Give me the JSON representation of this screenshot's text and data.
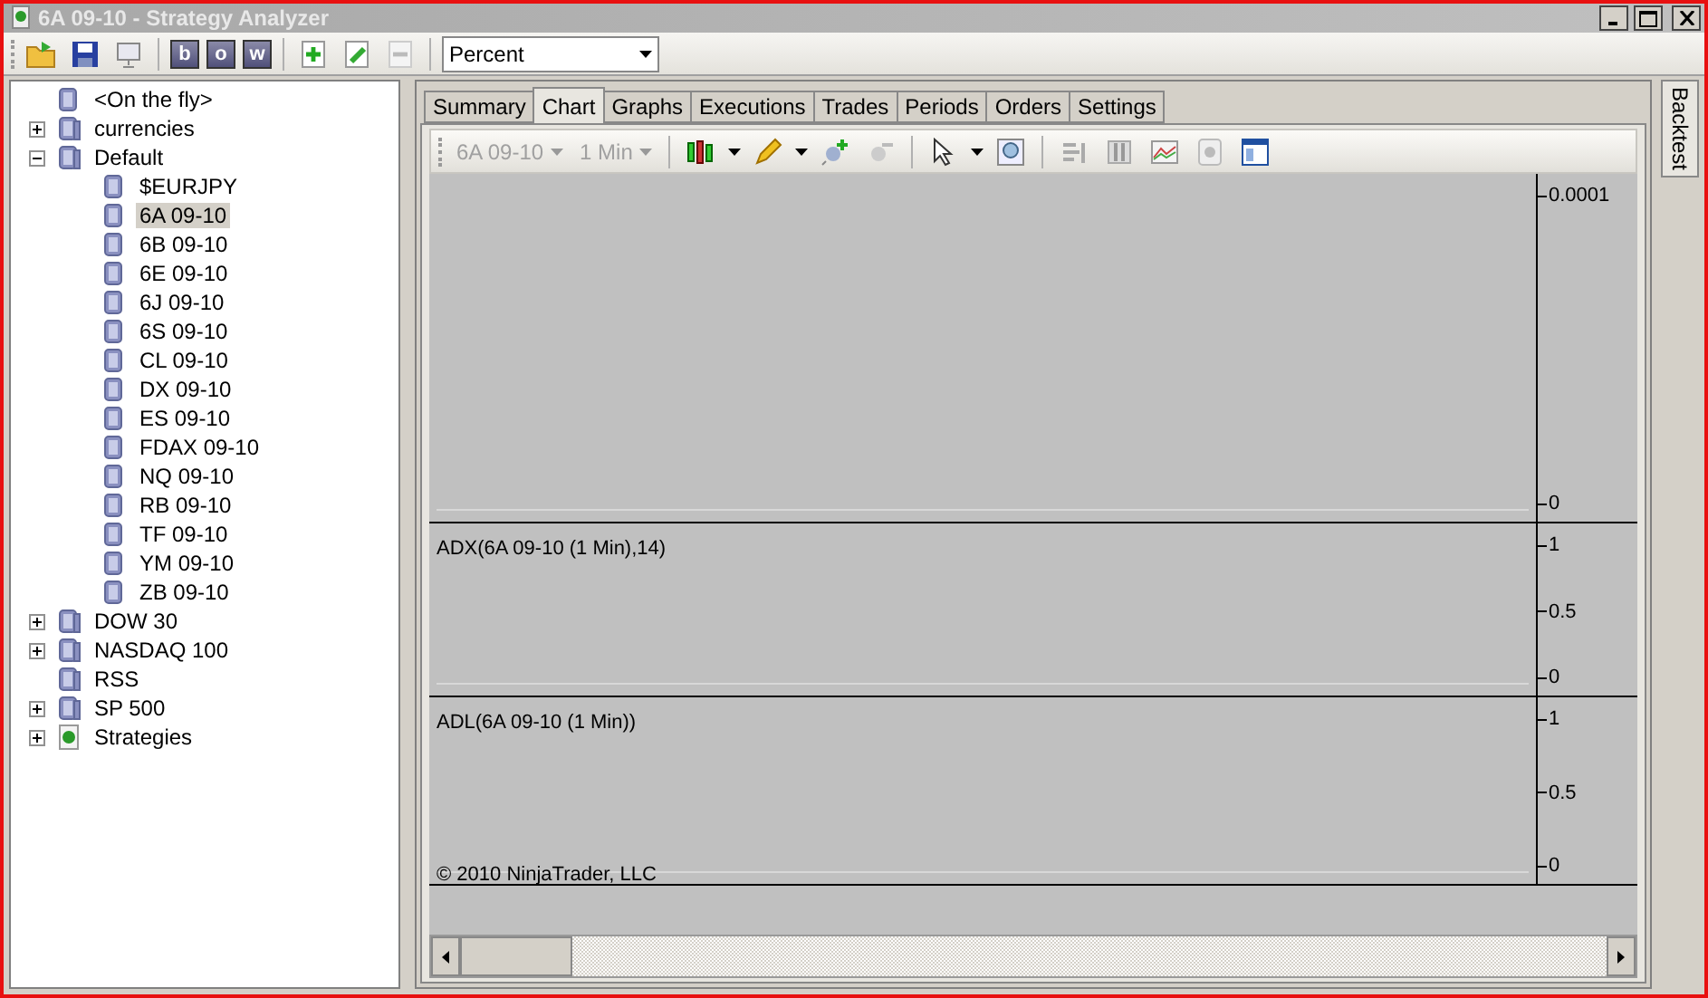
{
  "window": {
    "title": "6A 09-10 - Strategy Analyzer"
  },
  "toolbar": {
    "letter_buttons": [
      "b",
      "o",
      "w"
    ],
    "display_unit": "Percent"
  },
  "tree": [
    {
      "label": "<On the fly>",
      "kind": "list"
    },
    {
      "label": "currencies",
      "kind": "folder",
      "expanded": false
    },
    {
      "label": "Default",
      "kind": "folder",
      "expanded": true,
      "children": [
        {
          "label": "$EURJPY",
          "selected": false
        },
        {
          "label": "6A 09-10",
          "selected": true
        },
        {
          "label": "6B 09-10",
          "selected": false
        },
        {
          "label": "6E 09-10",
          "selected": false
        },
        {
          "label": "6J 09-10",
          "selected": false
        },
        {
          "label": "6S 09-10",
          "selected": false
        },
        {
          "label": "CL 09-10",
          "selected": false
        },
        {
          "label": "DX 09-10",
          "selected": false
        },
        {
          "label": "ES 09-10",
          "selected": false
        },
        {
          "label": "FDAX 09-10",
          "selected": false
        },
        {
          "label": "NQ 09-10",
          "selected": false
        },
        {
          "label": "RB 09-10",
          "selected": false
        },
        {
          "label": "TF 09-10",
          "selected": false
        },
        {
          "label": "YM 09-10",
          "selected": false
        },
        {
          "label": "ZB 09-10",
          "selected": false
        }
      ]
    },
    {
      "label": "DOW 30",
      "kind": "folder",
      "expanded": false
    },
    {
      "label": "NASDAQ 100",
      "kind": "folder",
      "expanded": false
    },
    {
      "label": "RSS",
      "kind": "folder"
    },
    {
      "label": "SP 500",
      "kind": "folder",
      "expanded": false
    },
    {
      "label": "Strategies",
      "kind": "strategies",
      "expanded": false
    }
  ],
  "tabs": [
    {
      "label": "Summary",
      "selected": false
    },
    {
      "label": "Chart",
      "selected": true
    },
    {
      "label": "Graphs",
      "selected": false
    },
    {
      "label": "Executions",
      "selected": false
    },
    {
      "label": "Trades",
      "selected": false
    },
    {
      "label": "Periods",
      "selected": false
    },
    {
      "label": "Orders",
      "selected": false
    },
    {
      "label": "Settings",
      "selected": false
    }
  ],
  "chart_toolbar": {
    "instrument": "6A 09-10",
    "interval": "1 Min",
    "disabled": true
  },
  "panels": [
    {
      "ticks": [
        "0.0001",
        "0"
      ]
    },
    {
      "title": "ADX(6A 09-10 (1 Min),14)",
      "ticks": [
        "1",
        "0.5",
        "0"
      ]
    },
    {
      "title": "ADL(6A 09-10 (1 Min))",
      "ticks": [
        "1",
        "0.5",
        "0"
      ]
    }
  ],
  "copyright": "© 2010 NinjaTrader, LLC",
  "side_tab": {
    "label": "Backtest"
  }
}
